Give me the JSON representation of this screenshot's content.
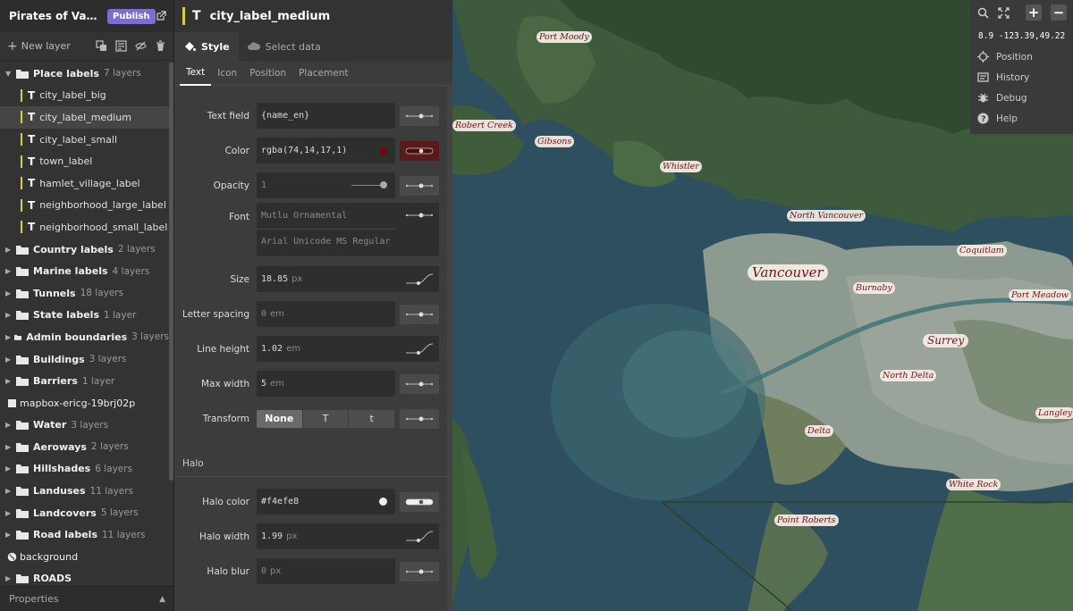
{
  "app": {
    "title": "Pirates of Vancouver",
    "title_display": "Pirates of Vanco...",
    "publish_label": "Publish"
  },
  "toolbar": {
    "new_layer_label": "New layer"
  },
  "layers": {
    "place_labels": {
      "name": "Place labels",
      "count": "7 layers",
      "children": [
        "city_label_big",
        "city_label_medium",
        "city_label_small",
        "town_label",
        "hamlet_village_label",
        "neighborhood_large_label",
        "neighborhood_small_label"
      ]
    },
    "groups": [
      {
        "name": "Country labels",
        "count": "2 layers"
      },
      {
        "name": "Marine labels",
        "count": "4 layers"
      },
      {
        "name": "Tunnels",
        "count": "18 layers"
      },
      {
        "name": "State labels",
        "count": "1 layer"
      },
      {
        "name": "Admin boundaries",
        "count": "3 layers"
      },
      {
        "name": "Buildings",
        "count": "3 layers"
      },
      {
        "name": "Barriers",
        "count": "1 layer"
      }
    ],
    "mapbox_layer": "mapbox-ericg-19brj02p",
    "groups2": [
      {
        "name": "Water",
        "count": "3 layers"
      },
      {
        "name": "Aeroways",
        "count": "2 layers"
      },
      {
        "name": "Hillshades",
        "count": "6 layers"
      },
      {
        "name": "Landuses",
        "count": "11 layers"
      },
      {
        "name": "Landcovers",
        "count": "5 layers"
      },
      {
        "name": "Road labels",
        "count": "11 layers"
      }
    ],
    "background": "background",
    "partial_row": "ROADS"
  },
  "properties_label": "Properties",
  "panel": {
    "layer_name": "city_label_medium",
    "tabs": {
      "style": "Style",
      "select_data": "Select data"
    },
    "subtabs": [
      "Text",
      "Icon",
      "Position",
      "Placement"
    ],
    "props": {
      "text_field": {
        "label": "Text field",
        "value": "{name_en}"
      },
      "color": {
        "label": "Color",
        "value": "rgba(74,14,17,1)",
        "swatch": "#4a0e11"
      },
      "opacity": {
        "label": "Opacity",
        "value": "1"
      },
      "font": {
        "label": "Font",
        "value1": "Mutlu  Ornamental",
        "value2": "Arial Unicode MS Regular"
      },
      "size": {
        "label": "Size",
        "value": "18.85",
        "unit": "px"
      },
      "letter_spacing": {
        "label": "Letter spacing",
        "value": "0",
        "unit": "em"
      },
      "line_height": {
        "label": "Line height",
        "value": "1.02",
        "unit": "em"
      },
      "max_width": {
        "label": "Max width",
        "value": "5",
        "unit": "em"
      },
      "transform": {
        "label": "Transform",
        "options": [
          "None",
          "T",
          "t"
        ],
        "selected": "None"
      }
    },
    "halo": {
      "heading": "Halo",
      "color": {
        "label": "Halo color",
        "value": "#f4efe8"
      },
      "width": {
        "label": "Halo width",
        "value": "1.99",
        "unit": "px"
      },
      "blur": {
        "label": "Halo blur",
        "value": "0",
        "unit": "px"
      }
    }
  },
  "map": {
    "zoom_coords": "8.9 -123.39,49.22",
    "menu": [
      "Position",
      "History",
      "Debug",
      "Help"
    ],
    "labels": [
      "Port Moody",
      "Robert Creek",
      "Gibsons",
      "Whistler",
      "North Vancouver",
      "Coquitlam",
      "Vancouver",
      "Burnaby",
      "Port Meadow",
      "Surrey",
      "North Delta",
      "Langley",
      "Delta",
      "White Rock",
      "Point Roberts"
    ]
  },
  "colors": {
    "accent": "#7a6fd0",
    "layer_bar": "#d4d13a",
    "label_text": "#4a0e11",
    "halo": "#f4efe8"
  }
}
